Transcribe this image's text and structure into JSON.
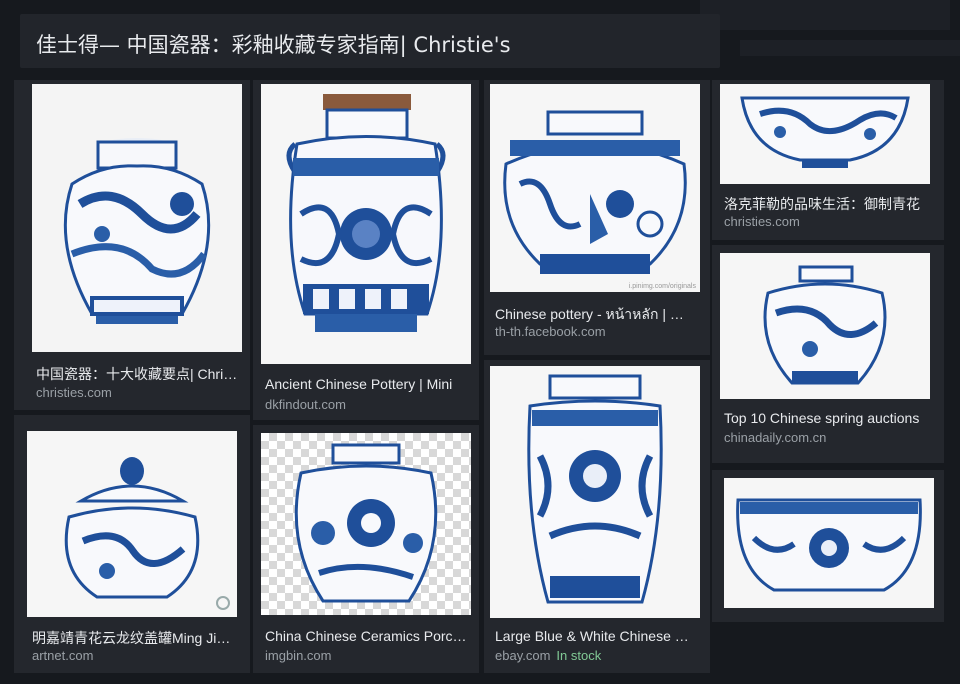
{
  "page_title": "佳士得— 中国瓷器：彩釉收藏专家指南| Christie's",
  "results": [
    {
      "title": "中国瓷器：十大收藏要点| Christie's",
      "source": "christies.com"
    },
    {
      "title": "Ancient Chinese Pottery | Mini",
      "source": "dkfindout.com"
    },
    {
      "title": "Chinese pottery - หน้าหลัก | Facebook",
      "source": "th-th.facebook.com",
      "watermark": "i.pinimg.com/originals"
    },
    {
      "title": "洛克菲勒的品味生活：御制青花",
      "source": "christies.com"
    },
    {
      "title": "Top 10 Chinese spring auctions",
      "source": "chinadaily.com.cn"
    },
    {
      "title": "明嘉靖青花云龙纹盖罐Ming Jiajing",
      "source": "artnet.com"
    },
    {
      "title": "China Chinese Ceramics Porcelain",
      "source": "imgbin.com"
    },
    {
      "title": "Large Blue & White Chinese Vase",
      "source": "ebay.com",
      "stock": "In stock"
    }
  ],
  "colors": {
    "porcelain_blue": "#1f4f9a",
    "background": "#16191e",
    "card": "#24272d",
    "stock_green": "#81c995"
  }
}
